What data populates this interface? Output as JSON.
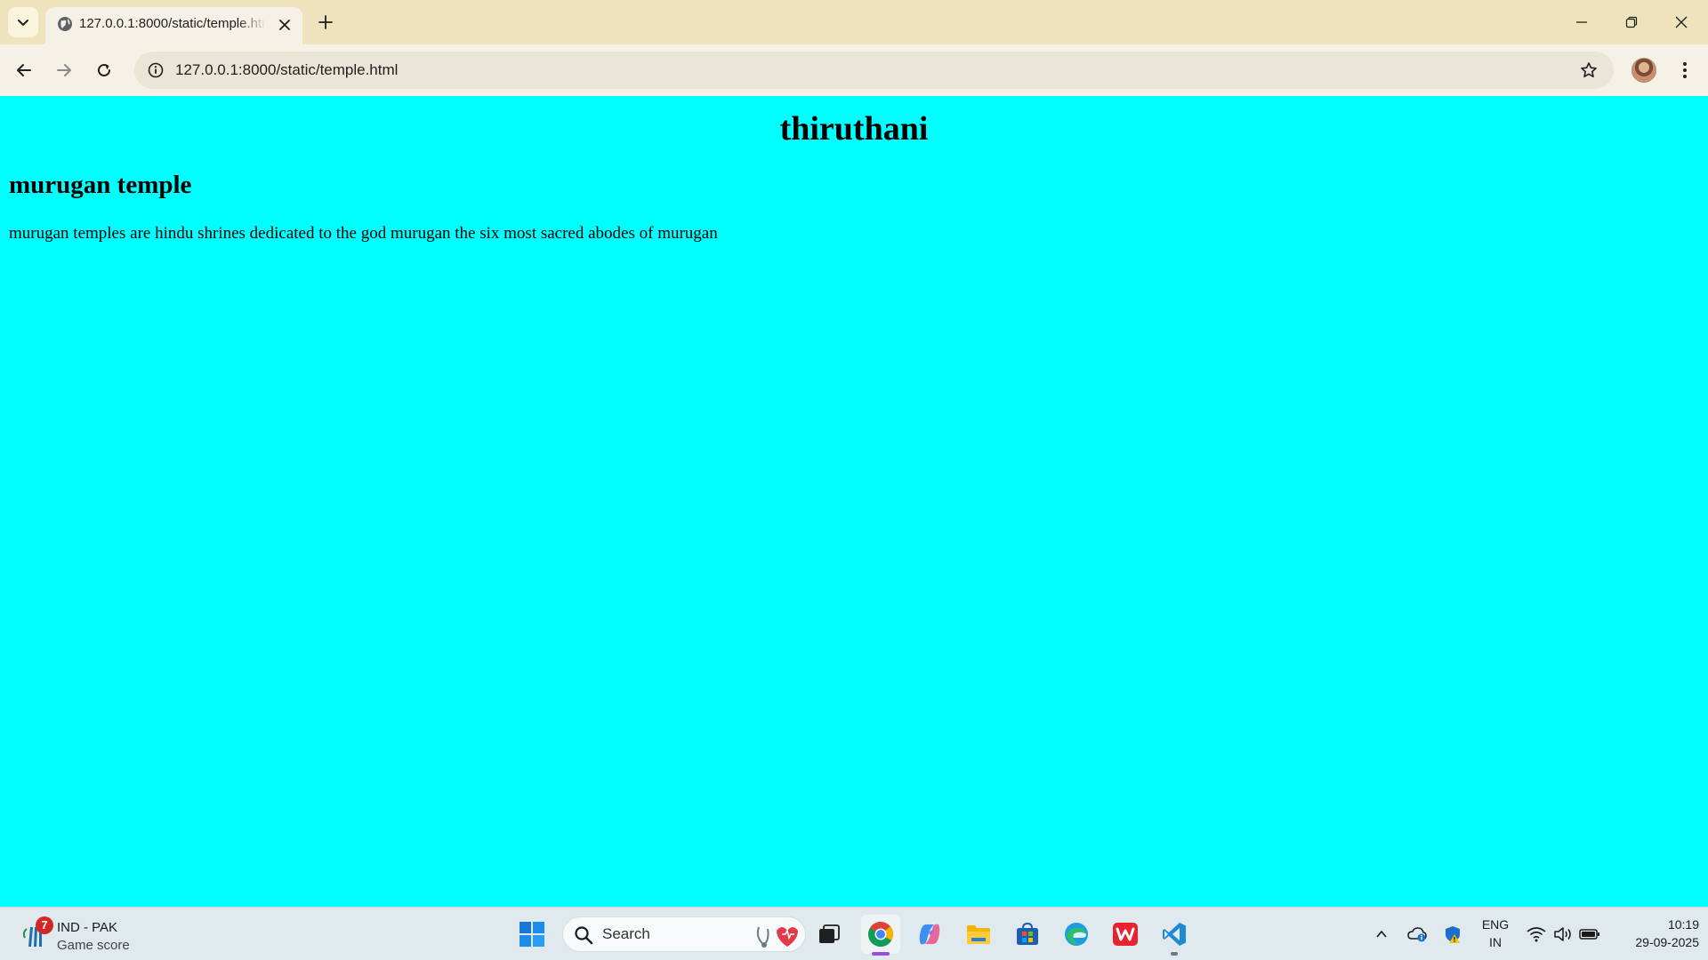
{
  "browser": {
    "tab": {
      "title": "127.0.0.1:8000/static/temple.html"
    },
    "address_bar": {
      "url": "127.0.0.1:8000/static/temple.html"
    }
  },
  "page": {
    "title": "thiruthani",
    "heading": "murugan temple",
    "paragraph": "murugan temples are hindu shrines dedicated to the god murugan the six most sacred abodes of murugan",
    "background_color": "#00ffff"
  },
  "taskbar": {
    "widget": {
      "badge": "7",
      "title": "IND - PAK",
      "subtitle": "Game score"
    },
    "search": {
      "label": "Search"
    },
    "apps": [
      "start-icon",
      "task-view-icon",
      "chrome-icon",
      "copilot-icon",
      "file-explorer-icon",
      "ms-store-icon",
      "edge-icon",
      "wps-office-icon",
      "vscode-icon"
    ],
    "tray": {
      "lang_primary": "ENG",
      "lang_secondary": "IN",
      "time": "10:19",
      "date": "29-09-2025"
    }
  }
}
